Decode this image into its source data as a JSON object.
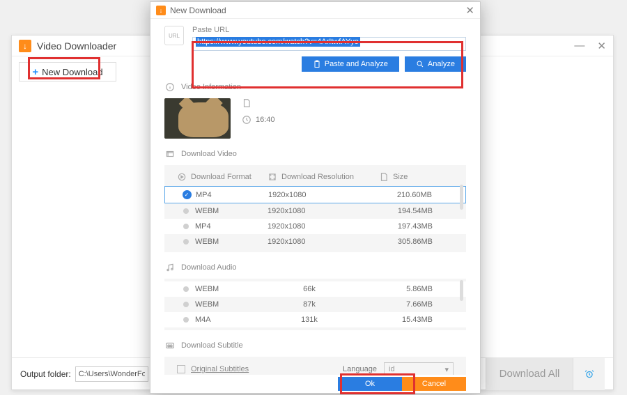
{
  "main": {
    "title": "Video Downloader",
    "new_download_label": "New Download",
    "output_folder_label": "Output folder:",
    "output_folder_value": "C:\\Users\\WonderFox\\Docum",
    "download_all_label": "Download All"
  },
  "dialog": {
    "title": "New Download",
    "url": {
      "label": "Paste URL",
      "value": "https://www.youtube.com/watch?v=4ArItwfAYyo",
      "paste_analyze_label": "Paste and Analyze",
      "analyze_label": "Analyze"
    },
    "video_info": {
      "section_label": "Video Information",
      "duration": "16:40"
    },
    "download_video": {
      "section_label": "Download Video",
      "head_format": "Download Format",
      "head_resolution": "Download Resolution",
      "head_size": "Size",
      "rows": [
        {
          "format": "MP4",
          "resolution": "1920x1080",
          "size": "210.60MB",
          "selected": true
        },
        {
          "format": "WEBM",
          "resolution": "1920x1080",
          "size": "194.54MB",
          "selected": false
        },
        {
          "format": "MP4",
          "resolution": "1920x1080",
          "size": "197.43MB",
          "selected": false
        },
        {
          "format": "WEBM",
          "resolution": "1920x1080",
          "size": "305.86MB",
          "selected": false
        }
      ]
    },
    "download_audio": {
      "section_label": "Download Audio",
      "rows": [
        {
          "format": "WEBM",
          "bitrate": "66k",
          "size": "5.86MB"
        },
        {
          "format": "WEBM",
          "bitrate": "87k",
          "size": "7.66MB"
        },
        {
          "format": "M4A",
          "bitrate": "131k",
          "size": "15.43MB"
        }
      ]
    },
    "subtitle": {
      "section_label": "Download Subtitle",
      "original_label": "Original Subtitles",
      "language_label": "Language",
      "language_value": "id"
    },
    "buttons": {
      "ok": "Ok",
      "cancel": "Cancel"
    }
  }
}
